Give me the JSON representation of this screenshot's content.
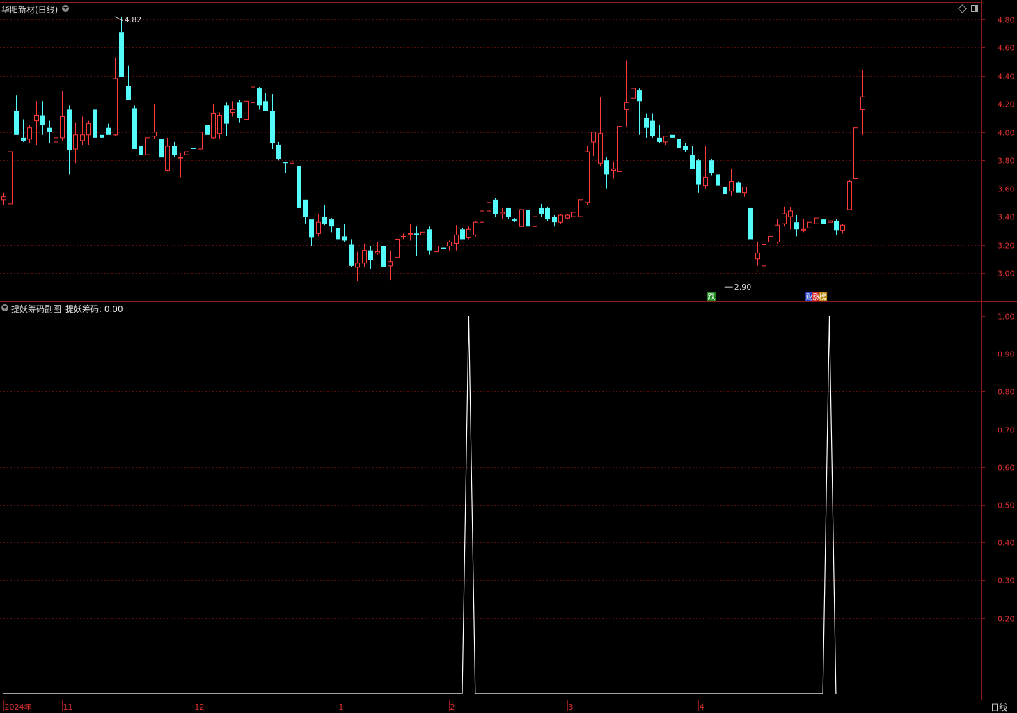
{
  "header": {
    "stock_title": "华阳新材(日线)",
    "indicator_name": "提妖筹码副图",
    "indicator_value_label": "提妖筹码: 0.00"
  },
  "footer": {
    "period_label": "日线"
  },
  "colors": {
    "background": "#000000",
    "frame": "#8b1a1a",
    "grid": "#5a1010",
    "axis_text": "#e03030",
    "up": "#ff3b3b",
    "down": "#54fcfc",
    "indicator_line": "#ffffff"
  },
  "chart_data": [
    {
      "type": "candlestick",
      "title": "华阳新材(日线)",
      "ylim": [
        2.88,
        4.85
      ],
      "yticks": [
        "4.80",
        "4.60",
        "4.40",
        "4.20",
        "4.00",
        "3.80",
        "3.60",
        "3.40",
        "3.20",
        "3.00"
      ],
      "x_month_labels": [
        {
          "label": "2024年",
          "index": 0
        },
        {
          "label": "11",
          "index": 9
        },
        {
          "label": "12",
          "index": 29
        },
        {
          "label": "1",
          "index": 51
        },
        {
          "label": "2",
          "index": 68
        },
        {
          "label": "3",
          "index": 86
        },
        {
          "label": "4",
          "index": 106
        }
      ],
      "annotations": [
        {
          "text": "4.82",
          "index": 17,
          "value": 4.82
        },
        {
          "text": "2.90",
          "index": 110,
          "value": 2.9
        }
      ],
      "markers": [
        {
          "text": "跌",
          "index": 108,
          "bg": "#1a8a1a"
        },
        {
          "text": "财",
          "index": 123,
          "bg": "#2a44cc"
        },
        {
          "text": "涨",
          "index": 124,
          "bg": "#cc2222"
        },
        {
          "text": "榜",
          "index": 125,
          "bg": "#b8860b"
        }
      ],
      "candles": [
        [
          3.52,
          3.57,
          3.48,
          3.54
        ],
        [
          3.49,
          3.87,
          3.43,
          3.86
        ],
        [
          4.15,
          4.26,
          3.98,
          3.98
        ],
        [
          3.96,
          4.09,
          3.93,
          3.94
        ],
        [
          3.95,
          4.05,
          3.92,
          4.03
        ],
        [
          4.08,
          4.22,
          3.91,
          4.12
        ],
        [
          4.12,
          4.22,
          3.98,
          4.05
        ],
        [
          4.03,
          4.08,
          3.92,
          4.0
        ],
        [
          3.93,
          4.13,
          3.91,
          3.96
        ],
        [
          3.96,
          4.29,
          3.94,
          4.11
        ],
        [
          4.16,
          4.19,
          3.7,
          3.87
        ],
        [
          3.88,
          4.07,
          3.78,
          3.98
        ],
        [
          3.94,
          4.11,
          3.91,
          3.98
        ],
        [
          3.98,
          4.08,
          3.91,
          4.06
        ],
        [
          4.16,
          4.18,
          3.94,
          3.96
        ],
        [
          3.98,
          4.04,
          3.92,
          3.96
        ],
        [
          4.03,
          4.06,
          3.98,
          3.98
        ],
        [
          3.98,
          4.53,
          3.97,
          4.38
        ],
        [
          4.71,
          4.82,
          4.41,
          4.39
        ],
        [
          4.33,
          4.47,
          4.23,
          4.23
        ],
        [
          4.17,
          4.19,
          3.98,
          3.88
        ],
        [
          3.9,
          3.93,
          3.68,
          3.84
        ],
        [
          3.84,
          3.98,
          3.83,
          3.96
        ],
        [
          3.97,
          4.2,
          3.95,
          4.0
        ],
        [
          3.95,
          3.97,
          3.82,
          3.82
        ],
        [
          3.73,
          3.96,
          3.72,
          3.9
        ],
        [
          3.9,
          3.93,
          3.82,
          3.84
        ],
        [
          3.82,
          3.85,
          3.68,
          3.82
        ],
        [
          3.84,
          3.87,
          3.79,
          3.86
        ],
        [
          3.89,
          3.94,
          3.85,
          3.88
        ],
        [
          3.88,
          4.04,
          3.85,
          4.0
        ],
        [
          4.05,
          4.07,
          3.97,
          3.98
        ],
        [
          3.96,
          4.2,
          3.95,
          4.13
        ],
        [
          3.99,
          4.14,
          3.95,
          4.12
        ],
        [
          4.19,
          4.21,
          3.97,
          4.06
        ],
        [
          4.14,
          4.22,
          4.11,
          4.16
        ],
        [
          4.21,
          4.23,
          4.07,
          4.1
        ],
        [
          4.09,
          4.23,
          4.08,
          4.22
        ],
        [
          4.21,
          4.33,
          4.2,
          4.32
        ],
        [
          4.31,
          4.32,
          4.16,
          4.19
        ],
        [
          4.22,
          4.28,
          4.15,
          4.15
        ],
        [
          4.15,
          4.27,
          3.88,
          3.92
        ],
        [
          3.91,
          3.93,
          3.8,
          3.81
        ],
        [
          3.79,
          3.79,
          3.71,
          3.78
        ],
        [
          3.78,
          3.83,
          3.71,
          3.79
        ],
        [
          3.76,
          3.78,
          3.47,
          3.46
        ],
        [
          3.52,
          3.52,
          3.35,
          3.4
        ],
        [
          3.38,
          3.38,
          3.19,
          3.25
        ],
        [
          3.28,
          3.42,
          3.26,
          3.36
        ],
        [
          3.4,
          3.48,
          3.34,
          3.35
        ],
        [
          3.38,
          3.39,
          3.29,
          3.33
        ],
        [
          3.32,
          3.38,
          3.21,
          3.24
        ],
        [
          3.26,
          3.35,
          3.22,
          3.23
        ],
        [
          3.2,
          3.24,
          3.04,
          3.05
        ],
        [
          3.04,
          3.15,
          2.94,
          3.07
        ],
        [
          3.07,
          3.21,
          3.04,
          3.16
        ],
        [
          3.16,
          3.19,
          3.03,
          3.09
        ],
        [
          3.14,
          3.22,
          3.13,
          3.15
        ],
        [
          3.19,
          3.21,
          3.03,
          3.04
        ],
        [
          3.05,
          3.16,
          2.95,
          3.08
        ],
        [
          3.11,
          3.25,
          3.1,
          3.24
        ],
        [
          3.26,
          3.28,
          3.24,
          3.26
        ],
        [
          3.28,
          3.35,
          3.23,
          3.28
        ],
        [
          3.28,
          3.33,
          3.12,
          3.27
        ],
        [
          3.27,
          3.31,
          3.16,
          3.29
        ],
        [
          3.31,
          3.33,
          3.13,
          3.16
        ],
        [
          3.15,
          3.29,
          3.1,
          3.19
        ],
        [
          3.18,
          3.2,
          3.12,
          3.17
        ],
        [
          3.19,
          3.23,
          3.16,
          3.22
        ],
        [
          3.21,
          3.34,
          3.16,
          3.27
        ],
        [
          3.31,
          3.32,
          3.24,
          3.24
        ],
        [
          3.25,
          3.33,
          3.24,
          3.31
        ],
        [
          3.27,
          3.37,
          3.26,
          3.36
        ],
        [
          3.36,
          3.46,
          3.33,
          3.44
        ],
        [
          3.44,
          3.5,
          3.41,
          3.5
        ],
        [
          3.52,
          3.53,
          3.4,
          3.42
        ],
        [
          3.42,
          3.46,
          3.38,
          3.43
        ],
        [
          3.46,
          3.46,
          3.38,
          3.4
        ],
        [
          3.38,
          3.39,
          3.36,
          3.37
        ],
        [
          3.33,
          3.45,
          3.33,
          3.45
        ],
        [
          3.45,
          3.46,
          3.31,
          3.33
        ],
        [
          3.33,
          3.42,
          3.33,
          3.4
        ],
        [
          3.46,
          3.49,
          3.4,
          3.42
        ],
        [
          3.46,
          3.47,
          3.37,
          3.38
        ],
        [
          3.4,
          3.41,
          3.33,
          3.36
        ],
        [
          3.36,
          3.42,
          3.35,
          3.41
        ],
        [
          3.39,
          3.42,
          3.38,
          3.41
        ],
        [
          3.4,
          3.45,
          3.36,
          3.43
        ],
        [
          3.4,
          3.6,
          3.38,
          3.52
        ],
        [
          3.5,
          3.9,
          3.48,
          3.86
        ],
        [
          3.93,
          4.0,
          3.83,
          4.0
        ],
        [
          3.78,
          4.25,
          3.76,
          3.99
        ],
        [
          3.8,
          3.82,
          3.6,
          3.7
        ],
        [
          3.73,
          3.79,
          3.67,
          3.74
        ],
        [
          3.72,
          4.13,
          3.66,
          4.04
        ],
        [
          4.16,
          4.51,
          4.04,
          4.21
        ],
        [
          4.24,
          4.4,
          4.08,
          4.31
        ],
        [
          4.3,
          4.31,
          3.98,
          4.22
        ],
        [
          4.1,
          4.13,
          3.96,
          4.03
        ],
        [
          4.08,
          4.13,
          3.96,
          3.97
        ],
        [
          3.96,
          4.05,
          3.92,
          3.93
        ],
        [
          3.93,
          3.96,
          3.91,
          3.97
        ],
        [
          3.98,
          4.0,
          3.95,
          3.96
        ],
        [
          3.95,
          3.96,
          3.85,
          3.89
        ],
        [
          3.9,
          3.92,
          3.86,
          3.87
        ],
        [
          3.84,
          3.9,
          3.74,
          3.74
        ],
        [
          3.8,
          3.81,
          3.57,
          3.63
        ],
        [
          3.62,
          3.9,
          3.6,
          3.68
        ],
        [
          3.8,
          3.81,
          3.69,
          3.71
        ],
        [
          3.7,
          3.7,
          3.61,
          3.62
        ],
        [
          3.61,
          3.64,
          3.51,
          3.56
        ],
        [
          3.58,
          3.74,
          3.55,
          3.65
        ],
        [
          3.64,
          3.65,
          3.57,
          3.57
        ],
        [
          3.57,
          3.61,
          3.54,
          3.61
        ],
        [
          3.46,
          3.46,
          3.24,
          3.24
        ],
        [
          3.1,
          3.22,
          3.05,
          3.14
        ],
        [
          3.05,
          3.25,
          2.9,
          3.2
        ],
        [
          3.22,
          3.32,
          3.2,
          3.26
        ],
        [
          3.22,
          3.38,
          3.21,
          3.34
        ],
        [
          3.35,
          3.47,
          3.33,
          3.42
        ],
        [
          3.4,
          3.47,
          3.31,
          3.44
        ],
        [
          3.36,
          3.41,
          3.26,
          3.31
        ],
        [
          3.3,
          3.38,
          3.29,
          3.31
        ],
        [
          3.32,
          3.37,
          3.3,
          3.36
        ],
        [
          3.35,
          3.42,
          3.33,
          3.39
        ],
        [
          3.38,
          3.41,
          3.33,
          3.35
        ],
        [
          3.36,
          3.38,
          3.34,
          3.37
        ],
        [
          3.37,
          3.38,
          3.27,
          3.3
        ],
        [
          3.3,
          3.35,
          3.28,
          3.34
        ],
        [
          3.45,
          3.66,
          3.45,
          3.65
        ],
        [
          3.67,
          4.03,
          3.66,
          4.03
        ],
        [
          4.16,
          4.44,
          3.98,
          4.25
        ]
      ]
    },
    {
      "type": "line",
      "title": "提妖筹码副图",
      "series_name": "提妖筹码",
      "ylim": [
        0,
        1.0
      ],
      "yticks": [
        "1.00",
        "0.90",
        "0.80",
        "0.70",
        "0.60",
        "0.50",
        "0.40",
        "0.30",
        "0.20"
      ],
      "values": [
        0,
        0,
        0,
        0,
        0,
        0,
        0,
        0,
        0,
        0,
        0,
        0,
        0,
        0,
        0,
        0,
        0,
        0,
        0,
        0,
        0,
        0,
        0,
        0,
        0,
        0,
        0,
        0,
        0,
        0,
        0,
        0,
        0,
        0,
        0,
        0,
        0,
        0,
        0,
        0,
        0,
        0,
        0,
        0,
        0,
        0,
        0,
        0,
        0,
        0,
        0,
        0,
        0,
        0,
        0,
        0,
        0,
        0,
        0,
        0,
        0,
        0,
        0,
        0,
        0,
        0,
        0,
        0,
        0,
        0,
        0,
        1,
        0,
        0,
        0,
        0,
        0,
        0,
        0,
        0,
        0,
        0,
        0,
        0,
        0,
        0,
        0,
        0,
        0,
        0,
        0,
        0,
        0,
        0,
        0,
        0,
        0,
        0,
        0,
        0,
        0,
        0,
        0,
        0,
        0,
        0,
        0,
        0,
        0,
        0,
        0,
        0,
        0,
        0,
        0,
        0,
        0,
        0,
        0,
        0,
        0,
        0,
        0,
        0,
        0,
        0,
        1,
        0
      ]
    }
  ]
}
